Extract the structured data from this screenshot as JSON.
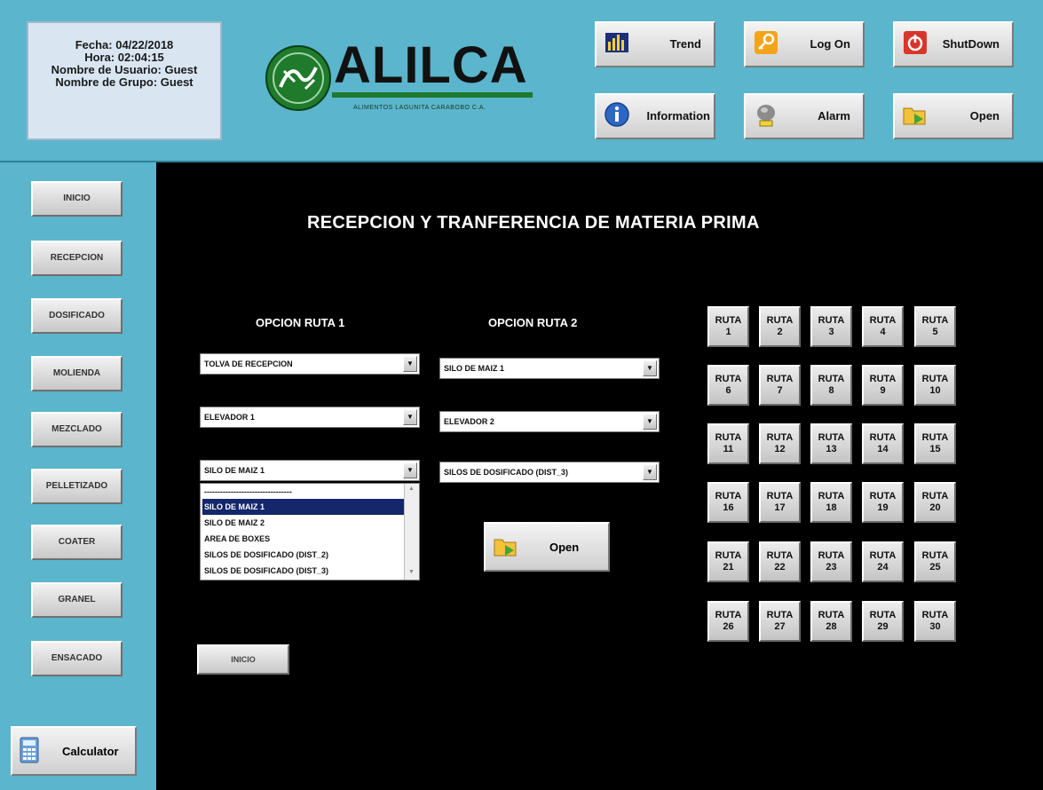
{
  "header": {
    "info": {
      "fecha": "Fecha: 04/22/2018",
      "hora": "Hora: 02:04:15",
      "usuario": "Nombre de Usuario: Guest",
      "grupo": "Nombre de Grupo: Guest"
    },
    "logo": {
      "name": "ALILCA",
      "subtitle": "ALIMENTOS LAGUNITA CARABOBO C.A."
    },
    "buttons": {
      "trend": "Trend",
      "logon": "Log On",
      "shutdown": "ShutDown",
      "information": "Information",
      "alarm": "Alarm",
      "open": "Open"
    }
  },
  "sidebar": {
    "items": [
      "INICIO",
      "RECEPCION",
      "DOSIFICADO",
      "MOLIENDA",
      "MEZCLADO",
      "PELLETIZADO",
      "COATER",
      "GRANEL",
      "ENSACADO"
    ],
    "calculator": "Calculator"
  },
  "main": {
    "title": "RECEPCION Y TRANFERENCIA DE MATERIA PRIMA",
    "ruta1": {
      "heading": "OPCION RUTA 1",
      "combo1": "TOLVA DE RECEPCION",
      "combo2": "ELEVADOR 1",
      "combo3": "SILO DE MAIZ 1"
    },
    "ruta2": {
      "heading": "OPCION RUTA 2",
      "combo1": "SILO DE MAIZ 1",
      "combo2": "ELEVADOR 2",
      "combo3": "SILOS DE DOSIFICADO (DIST_3)"
    },
    "dropdown_options": [
      "---------------------------------",
      "SILO DE MAIZ 1",
      "SILO DE MAIZ 2",
      "AREA DE BOXES",
      "SILOS DE DOSIFICADO (DIST_2)",
      "SILOS DE DOSIFICADO (DIST_3)"
    ],
    "dropdown_selected_index": 1,
    "open_label": "Open",
    "inicio_label": "INICIO",
    "ruta_prefix": "RUTA",
    "rutas": [
      "1",
      "2",
      "3",
      "4",
      "5",
      "6",
      "7",
      "8",
      "9",
      "10",
      "11",
      "12",
      "13",
      "14",
      "15",
      "16",
      "17",
      "18",
      "19",
      "20",
      "21",
      "22",
      "23",
      "24",
      "25",
      "26",
      "27",
      "28",
      "29",
      "30"
    ]
  },
  "colors": {
    "panel_bg": "#5ab5cd",
    "main_bg": "#000000",
    "selection": "#13276a",
    "logo_green": "#1f7a2c"
  }
}
